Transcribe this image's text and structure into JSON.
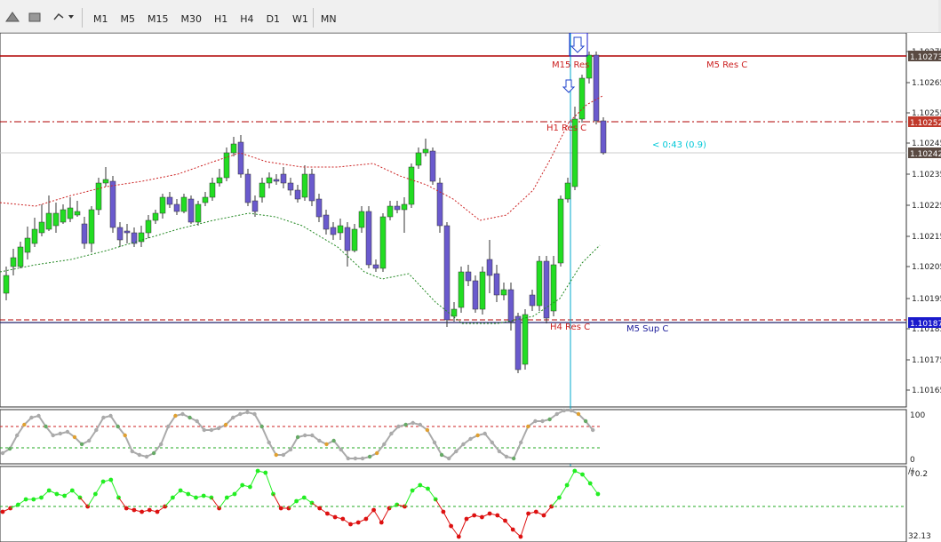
{
  "toolbar": {
    "timeframes": [
      "M1",
      "M5",
      "M15",
      "M30",
      "H1",
      "H4",
      "D1",
      "W1",
      "MN"
    ],
    "icons": [
      "triangle-up-icon",
      "rectangle-icon",
      "shapes-dropdown-icon"
    ]
  },
  "chart": {
    "price_axis": {
      "ticks": [
        "1.10275",
        "1.10265",
        "1.10255",
        "1.10245",
        "1.10235",
        "1.10225",
        "1.10215",
        "1.10205",
        "1.10195",
        "1.10185",
        "1.10175",
        "1.10165"
      ],
      "price_labels": [
        {
          "text": "1.10273",
          "bg": "#5a4a42"
        },
        {
          "text": "1.10252",
          "bg": "#c0392b"
        },
        {
          "text": "1.10242",
          "bg": "#5a4a42"
        },
        {
          "text": "1.10187",
          "bg": "#1a1acc"
        }
      ]
    },
    "levels": [
      {
        "label": "M15 Res",
        "color": "#cc2222"
      },
      {
        "label": "M5 Res C",
        "color": "#cc2222"
      },
      {
        "label": "H1 Res C",
        "color": "#cc2222"
      },
      {
        "label": "H4 Res C",
        "color": "#cc2222"
      },
      {
        "label": "M5 Sup C",
        "color": "#1a1a99"
      }
    ],
    "timer_text": "< 0:43 (0.9)",
    "colors": {
      "bull": "#22dd22",
      "bear": "#6a5acd",
      "res": "#b00000",
      "sup": "#22226a",
      "timer": "#00c8d8"
    }
  },
  "indicator1": {
    "ticks": [
      "100",
      "0"
    ]
  },
  "indicator2": {
    "ticks": [
      "70.2",
      "32.13"
    ],
    "corner": "//"
  }
}
